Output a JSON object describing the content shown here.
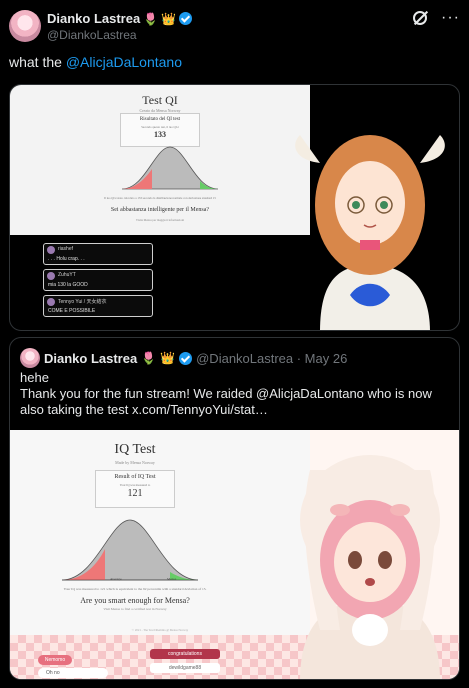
{
  "author": {
    "display_name": "Dianko Lastrea",
    "emojis": [
      "🌷",
      "👑"
    ],
    "handle": "@DiankoLastrea"
  },
  "header_actions": {
    "grok_icon": "grok-icon",
    "more": "···"
  },
  "tweet": {
    "text_prefix": "what the ",
    "mention": "@AlicjaDaLontano"
  },
  "media1": {
    "page_title": "Test QI",
    "page_subtitle": "Creato da Mensa Norway",
    "card_heading": "Risultato del QI test",
    "card_sub": "Secondo questo test, il tuo QI è",
    "card_value": "133",
    "note": "Il tuo QI è stato calcolato a 133 secondo la distribuzione normale con deviazione standard 15",
    "question": "Sei abbastanza intelligente per il Mensa?",
    "link": "Visita Mensa per maggiori informazioni",
    "chat": [
      {
        "name": "riashef",
        "message": ". . . Holu crap. . ."
      },
      {
        "name": "ZuhuYT",
        "message": "mia 130 la GOOD"
      },
      {
        "name": "Tennyo Yui / 天女結衣",
        "message": "COME E POSSIBILE"
      }
    ]
  },
  "quote": {
    "display_name": "Dianko Lastrea",
    "emojis": [
      "🌷",
      "👑"
    ],
    "handle_date": "@DiankoLastrea · May 26",
    "body_line1": "hehe",
    "body_line2": "Thank you for the fun stream! We raided @AlicjaDaLontano who is now also taking the test  x.com/TennyoYui/stat…",
    "media": {
      "page_title": "IQ Test",
      "page_subtitle": "Made by Mensa Norway",
      "card_heading": "Result of IQ Test",
      "card_sub": "Your IQ was measured to",
      "card_value": "121",
      "axis_left": "Average",
      "axis_right": "Mensa",
      "note": "Your IQ was measured to 121 which is equivalent to the 92 percentile with a standard deviation of 15.",
      "question": "Are you smart enough for Mensa?",
      "link": "Visit Mensa to find a certified test in Norway",
      "footer": "© 2021 - The Test Dilemma @ Mensa Norway",
      "chat": [
        "Nemomo",
        "Oh no",
        "congratulations",
        "dewildgame88"
      ]
    }
  },
  "colors": {
    "verified": "#1d9bf0",
    "link": "#1d9bf0",
    "background": "#000000"
  }
}
